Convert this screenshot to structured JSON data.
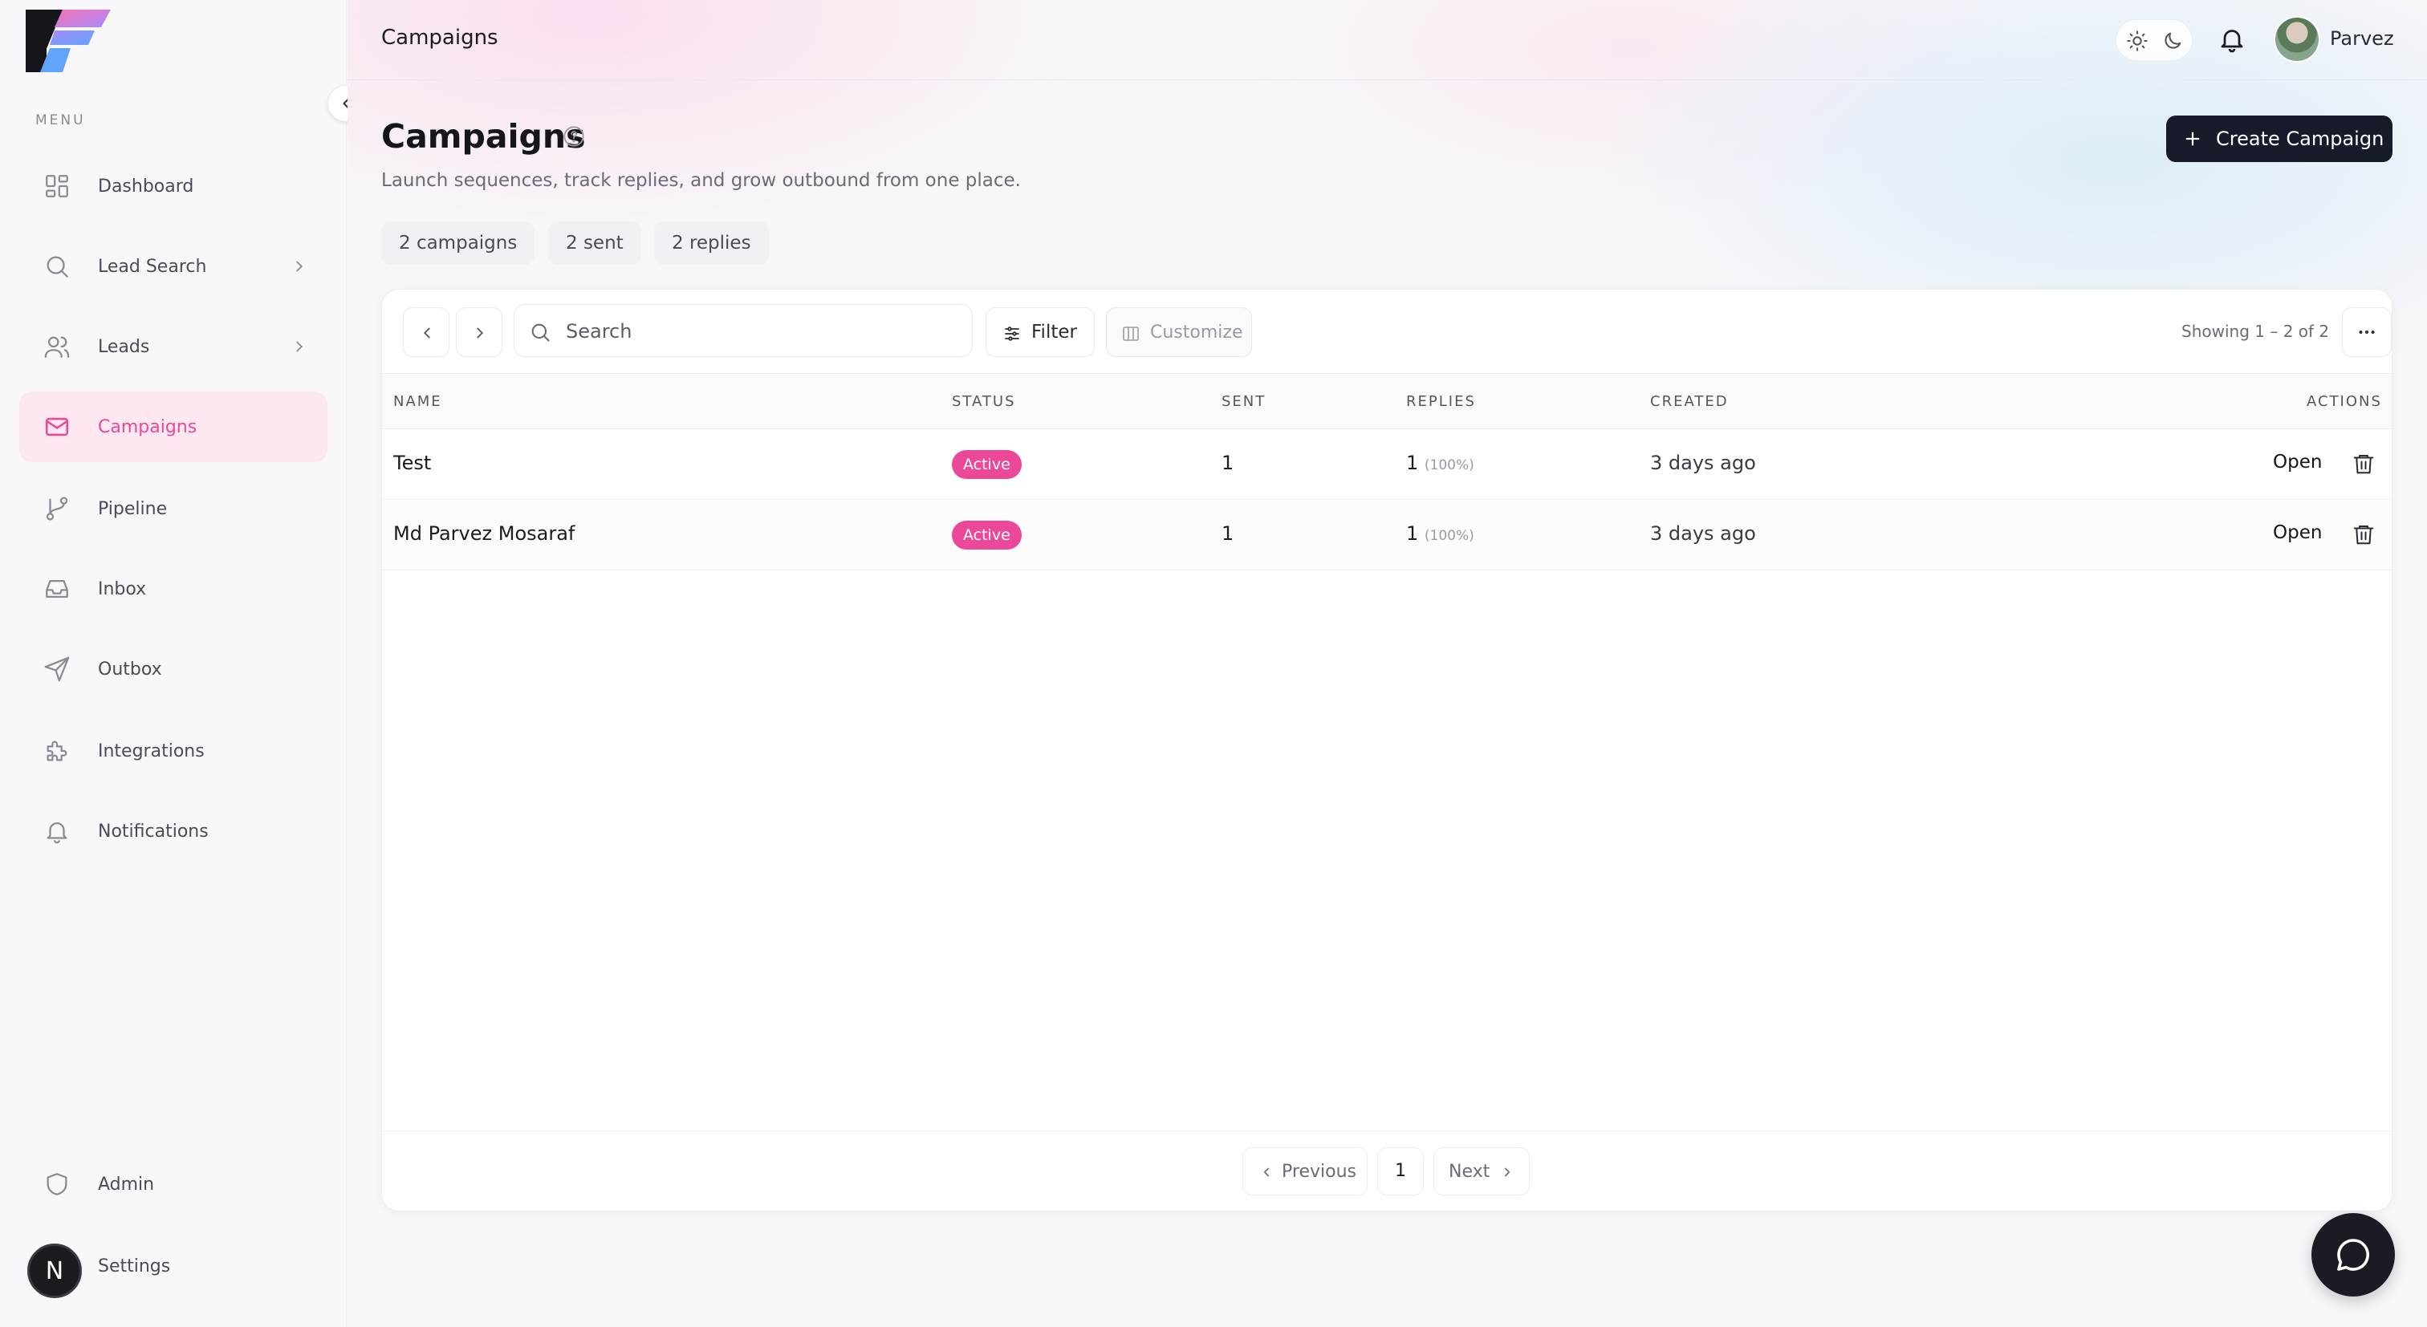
{
  "sidebar": {
    "menu_label": "MENU",
    "items": [
      {
        "label": "Dashboard",
        "icon": "dashboard-icon"
      },
      {
        "label": "Lead Search",
        "icon": "search-icon",
        "has_submenu": true
      },
      {
        "label": "Leads",
        "icon": "users-icon",
        "has_submenu": true
      },
      {
        "label": "Campaigns",
        "icon": "mail-icon",
        "active": true
      },
      {
        "label": "Pipeline",
        "icon": "pipeline-icon"
      },
      {
        "label": "Inbox",
        "icon": "inbox-icon"
      },
      {
        "label": "Outbox",
        "icon": "send-icon"
      },
      {
        "label": "Integrations",
        "icon": "puzzle-icon"
      },
      {
        "label": "Notifications",
        "icon": "bell-icon"
      }
    ],
    "bottom_items": [
      {
        "label": "Admin",
        "icon": "shield-icon"
      },
      {
        "label": "Settings",
        "icon": "settings-icon"
      }
    ],
    "avatar_initial": "N"
  },
  "topbar": {
    "title": "Campaigns",
    "user_name": "Parvez"
  },
  "page": {
    "title": "Campaigns",
    "subtitle": "Launch sequences, track replies, and grow outbound from one place.",
    "create_button": "Create Campaign",
    "stats": [
      "2 campaigns",
      "2 sent",
      "2 replies"
    ]
  },
  "toolbar": {
    "search_placeholder": "Search",
    "filter_label": "Filter",
    "customize_label": "Customize",
    "showing": "Showing 1 – 2 of 2"
  },
  "table": {
    "columns": [
      "NAME",
      "STATUS",
      "SENT",
      "REPLIES",
      "CREATED",
      "ACTIONS"
    ],
    "rows": [
      {
        "name": "Test",
        "status": "Active",
        "sent": "1",
        "replies": "1",
        "replies_pct": "(100%)",
        "created": "3 days ago",
        "action": "Open"
      },
      {
        "name": "Md Parvez Mosaraf",
        "status": "Active",
        "sent": "1",
        "replies": "1",
        "replies_pct": "(100%)",
        "created": "3 days ago",
        "action": "Open"
      }
    ]
  },
  "pagination": {
    "previous": "Previous",
    "current_page": "1",
    "next": "Next"
  },
  "colors": {
    "accent": "#ec4899",
    "dark": "#161a2a"
  }
}
